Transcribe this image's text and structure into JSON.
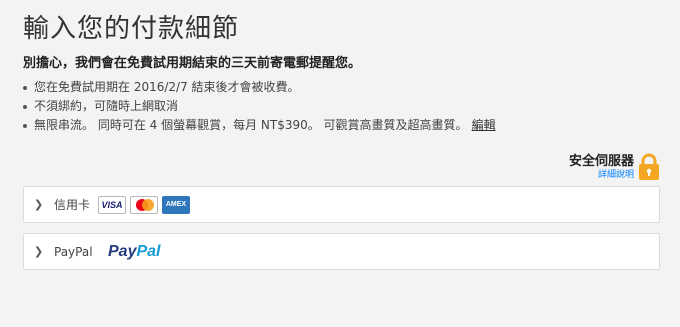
{
  "page": {
    "title": "輸入您的付款細節",
    "subtitle": "別擔心，我們會在免費試用期結束的三天前寄電郵提醒您。",
    "bullets": [
      "您在免費試用期在 2016/2/7 結束後才會被收費。",
      "不須綁約，可隨時上網取消",
      "無限串流。 同時可在 4 個螢幕觀賞，每月 NT$390。 可觀賞高畫質及超高畫質。"
    ],
    "edit_link": "編輯"
  },
  "secure": {
    "title": "安全伺服器",
    "details_link": "詳細說明",
    "lock_color": "#f5a623"
  },
  "payment_options": {
    "credit_card": {
      "label": "信用卡",
      "chevron": "❯",
      "cards": {
        "visa": "VISA",
        "mastercard": "mastercard",
        "amex": "AMEX"
      }
    },
    "paypal": {
      "label": "PayPal",
      "chevron": "❯",
      "logo_part1": "Pay",
      "logo_part2": "Pal"
    }
  }
}
